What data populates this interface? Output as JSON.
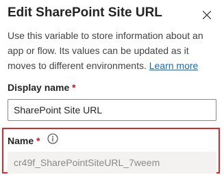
{
  "panel": {
    "title": "Edit SharePoint Site URL",
    "close_icon": "close-icon",
    "description_text": "Use this variable to store information about an app or flow. Its values can be updated as it moves to different environments.",
    "learn_more_label": "Learn more"
  },
  "display_name": {
    "label": "Display name",
    "required_mark": "*",
    "value": "SharePoint Site URL"
  },
  "name": {
    "label": "Name",
    "required_mark": "*",
    "info_icon": "info-icon",
    "value": "cr49f_SharePointSiteURL_7weem",
    "highlight_color": "#e3242b"
  },
  "colors": {
    "link": "#0f6cbd",
    "required": "#c50f1f",
    "disabled_field_bg": "#f3f2f1"
  }
}
